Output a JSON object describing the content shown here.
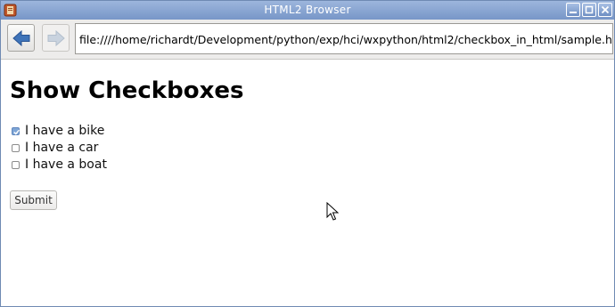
{
  "window": {
    "title": "HTML2 Browser",
    "colors": {
      "titlebar": "#7796c8",
      "accent": "#7fa6d6"
    }
  },
  "toolbar": {
    "back_icon": "back-arrow-icon",
    "forward_icon": "forward-arrow-icon",
    "url": "file:////home/richardt/Development/python/exp/hci/wxpython/html2/checkbox_in_html/sample.html"
  },
  "page": {
    "heading": "Show Checkboxes",
    "checkboxes": [
      {
        "label": "I have a bike",
        "checked": true
      },
      {
        "label": "I have a car",
        "checked": false
      },
      {
        "label": "I have a boat",
        "checked": false
      }
    ],
    "submit_label": "Submit"
  }
}
